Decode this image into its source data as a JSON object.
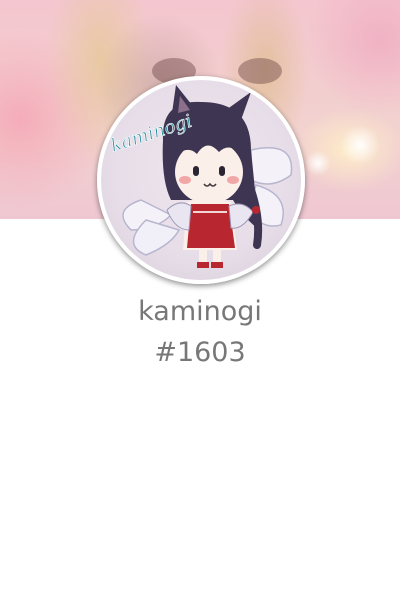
{
  "profile": {
    "username": "kaminogi",
    "user_number": "#1603",
    "avatar_text": "kaminogi"
  },
  "colors": {
    "text": "#777777",
    "background": "#ffffff",
    "avatar_border": "#ffffff"
  }
}
